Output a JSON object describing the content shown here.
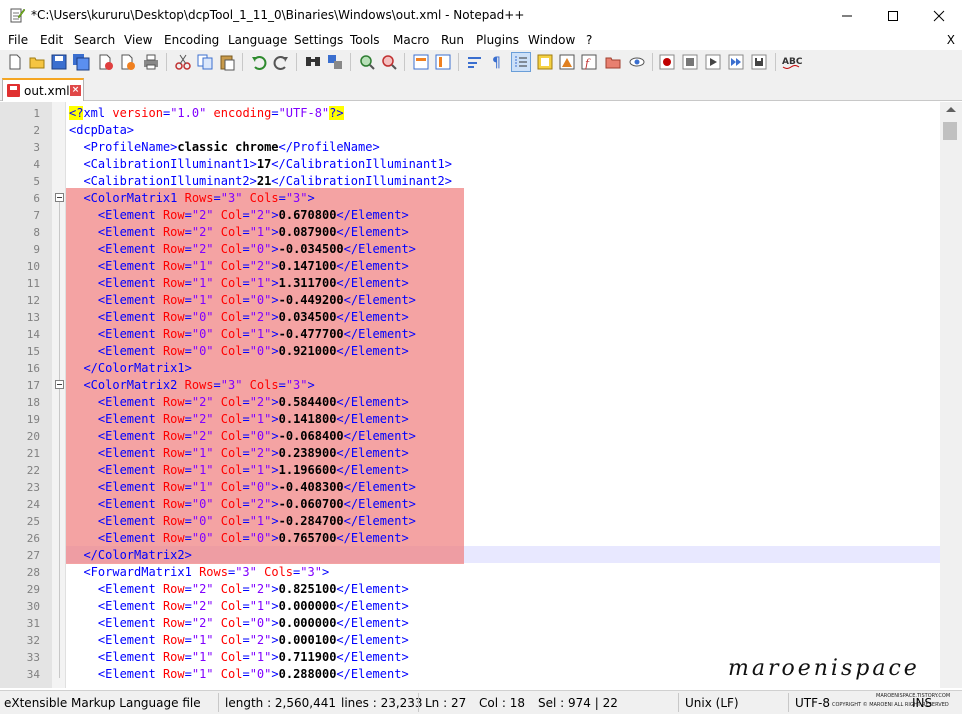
{
  "window": {
    "title": "*C:\\Users\\kururu\\Desktop\\dcpTool_1_11_0\\Binaries\\Windows\\out.xml - Notepad++"
  },
  "menu": {
    "items": [
      "File",
      "Edit",
      "Search",
      "View",
      "Encoding",
      "Language",
      "Settings",
      "Tools",
      "Macro",
      "Run",
      "Plugins",
      "Window",
      "?"
    ],
    "close": "X"
  },
  "toolbar": {
    "icons": [
      "new-file-icon",
      "open-file-icon",
      "save-icon",
      "save-all-icon",
      "close-icon",
      "close-all-icon",
      "print-icon",
      "cut-icon",
      "copy-icon",
      "paste-icon",
      "undo-icon",
      "redo-icon",
      "find-icon",
      "replace-icon",
      "zoom-in-icon",
      "zoom-out-icon",
      "sync-v-icon",
      "sync-h-icon",
      "wrap-icon",
      "all-chars-icon",
      "indent-guide-icon",
      "udl-icon",
      "doc-map-icon",
      "function-list-icon",
      "folder-workspace-icon",
      "monitor-icon",
      "record-macro-icon",
      "stop-record-icon",
      "play-macro-icon",
      "play-multiple-icon",
      "save-macro-icon",
      "spellcheck-icon"
    ]
  },
  "tab": {
    "label": "out.xml",
    "close": "×"
  },
  "editor": {
    "lines": [
      {
        "n": "1",
        "html": "<span class='pi'>&lt;?</span><span class='tagc'>xml</span> <span class='attr'>version</span><span class='tagc'>=</span><span class='val'>\"1.0\"</span> <span class='attr'>encoding</span><span class='tagc'>=</span><span class='val'>\"UTF-8\"</span><span class='pi'>?&gt;</span>"
      },
      {
        "n": "2",
        "html": "<span class='tagc'>&lt;dcpData&gt;</span>"
      },
      {
        "n": "3",
        "html": "  <span class='tagc'>&lt;ProfileName&gt;</span><span class='txt'>classic chrome</span><span class='tagc'>&lt;/ProfileName&gt;</span>"
      },
      {
        "n": "4",
        "html": "  <span class='tagc'>&lt;CalibrationIlluminant1&gt;</span><span class='txt'>17</span><span class='tagc'>&lt;/CalibrationIlluminant1&gt;</span>"
      },
      {
        "n": "5",
        "html": "  <span class='tagc'>&lt;CalibrationIlluminant2&gt;</span><span class='txt'>21</span><span class='tagc'>&lt;/CalibrationIlluminant2&gt;</span>"
      },
      {
        "n": "6",
        "html": "  <span class='tagc'>&lt;ColorMatrix1</span> <span class='attr'>Rows</span><span class='tagc'>=</span><span class='val'>\"3\"</span> <span class='attr'>Cols</span><span class='tagc'>=</span><span class='val'>\"3\"</span><span class='tagc'>&gt;</span>"
      },
      {
        "n": "7",
        "html": "    <span class='tagc'>&lt;Element</span> <span class='attr'>Row</span><span class='tagc'>=</span><span class='val'>\"2\"</span> <span class='attr'>Col</span><span class='tagc'>=</span><span class='val'>\"2\"</span><span class='tagc'>&gt;</span><span class='txt'>0.670800</span><span class='tagc'>&lt;/Element&gt;</span>"
      },
      {
        "n": "8",
        "html": "    <span class='tagc'>&lt;Element</span> <span class='attr'>Row</span><span class='tagc'>=</span><span class='val'>\"2\"</span> <span class='attr'>Col</span><span class='tagc'>=</span><span class='val'>\"1\"</span><span class='tagc'>&gt;</span><span class='txt'>0.087900</span><span class='tagc'>&lt;/Element&gt;</span>"
      },
      {
        "n": "9",
        "html": "    <span class='tagc'>&lt;Element</span> <span class='attr'>Row</span><span class='tagc'>=</span><span class='val'>\"2\"</span> <span class='attr'>Col</span><span class='tagc'>=</span><span class='val'>\"0\"</span><span class='tagc'>&gt;</span><span class='txt'>-0.034500</span><span class='tagc'>&lt;/Element&gt;</span>"
      },
      {
        "n": "10",
        "html": "    <span class='tagc'>&lt;Element</span> <span class='attr'>Row</span><span class='tagc'>=</span><span class='val'>\"1\"</span> <span class='attr'>Col</span><span class='tagc'>=</span><span class='val'>\"2\"</span><span class='tagc'>&gt;</span><span class='txt'>0.147100</span><span class='tagc'>&lt;/Element&gt;</span>"
      },
      {
        "n": "11",
        "html": "    <span class='tagc'>&lt;Element</span> <span class='attr'>Row</span><span class='tagc'>=</span><span class='val'>\"1\"</span> <span class='attr'>Col</span><span class='tagc'>=</span><span class='val'>\"1\"</span><span class='tagc'>&gt;</span><span class='txt'>1.311700</span><span class='tagc'>&lt;/Element&gt;</span>"
      },
      {
        "n": "12",
        "html": "    <span class='tagc'>&lt;Element</span> <span class='attr'>Row</span><span class='tagc'>=</span><span class='val'>\"1\"</span> <span class='attr'>Col</span><span class='tagc'>=</span><span class='val'>\"0\"</span><span class='tagc'>&gt;</span><span class='txt'>-0.449200</span><span class='tagc'>&lt;/Element&gt;</span>"
      },
      {
        "n": "13",
        "html": "    <span class='tagc'>&lt;Element</span> <span class='attr'>Row</span><span class='tagc'>=</span><span class='val'>\"0\"</span> <span class='attr'>Col</span><span class='tagc'>=</span><span class='val'>\"2\"</span><span class='tagc'>&gt;</span><span class='txt'>0.034500</span><span class='tagc'>&lt;/Element&gt;</span>"
      },
      {
        "n": "14",
        "html": "    <span class='tagc'>&lt;Element</span> <span class='attr'>Row</span><span class='tagc'>=</span><span class='val'>\"0\"</span> <span class='attr'>Col</span><span class='tagc'>=</span><span class='val'>\"1\"</span><span class='tagc'>&gt;</span><span class='txt'>-0.477700</span><span class='tagc'>&lt;/Element&gt;</span>"
      },
      {
        "n": "15",
        "html": "    <span class='tagc'>&lt;Element</span> <span class='attr'>Row</span><span class='tagc'>=</span><span class='val'>\"0\"</span> <span class='attr'>Col</span><span class='tagc'>=</span><span class='val'>\"0\"</span><span class='tagc'>&gt;</span><span class='txt'>0.921000</span><span class='tagc'>&lt;/Element&gt;</span>"
      },
      {
        "n": "16",
        "html": "  <span class='tagc'>&lt;/ColorMatrix1&gt;</span>"
      },
      {
        "n": "17",
        "html": "  <span class='tagc'>&lt;ColorMatrix2</span> <span class='attr'>Rows</span><span class='tagc'>=</span><span class='val'>\"3\"</span> <span class='attr'>Cols</span><span class='tagc'>=</span><span class='val'>\"3\"</span><span class='tagc'>&gt;</span>"
      },
      {
        "n": "18",
        "html": "    <span class='tagc'>&lt;Element</span> <span class='attr'>Row</span><span class='tagc'>=</span><span class='val'>\"2\"</span> <span class='attr'>Col</span><span class='tagc'>=</span><span class='val'>\"2\"</span><span class='tagc'>&gt;</span><span class='txt'>0.584400</span><span class='tagc'>&lt;/Element&gt;</span>"
      },
      {
        "n": "19",
        "html": "    <span class='tagc'>&lt;Element</span> <span class='attr'>Row</span><span class='tagc'>=</span><span class='val'>\"2\"</span> <span class='attr'>Col</span><span class='tagc'>=</span><span class='val'>\"1\"</span><span class='tagc'>&gt;</span><span class='txt'>0.141800</span><span class='tagc'>&lt;/Element&gt;</span>"
      },
      {
        "n": "20",
        "html": "    <span class='tagc'>&lt;Element</span> <span class='attr'>Row</span><span class='tagc'>=</span><span class='val'>\"2\"</span> <span class='attr'>Col</span><span class='tagc'>=</span><span class='val'>\"0\"</span><span class='tagc'>&gt;</span><span class='txt'>-0.068400</span><span class='tagc'>&lt;/Element&gt;</span>"
      },
      {
        "n": "21",
        "html": "    <span class='tagc'>&lt;Element</span> <span class='attr'>Row</span><span class='tagc'>=</span><span class='val'>\"1\"</span> <span class='attr'>Col</span><span class='tagc'>=</span><span class='val'>\"2\"</span><span class='tagc'>&gt;</span><span class='txt'>0.238900</span><span class='tagc'>&lt;/Element&gt;</span>"
      },
      {
        "n": "22",
        "html": "    <span class='tagc'>&lt;Element</span> <span class='attr'>Row</span><span class='tagc'>=</span><span class='val'>\"1\"</span> <span class='attr'>Col</span><span class='tagc'>=</span><span class='val'>\"1\"</span><span class='tagc'>&gt;</span><span class='txt'>1.196600</span><span class='tagc'>&lt;/Element&gt;</span>"
      },
      {
        "n": "23",
        "html": "    <span class='tagc'>&lt;Element</span> <span class='attr'>Row</span><span class='tagc'>=</span><span class='val'>\"1\"</span> <span class='attr'>Col</span><span class='tagc'>=</span><span class='val'>\"0\"</span><span class='tagc'>&gt;</span><span class='txt'>-0.408300</span><span class='tagc'>&lt;/Element&gt;</span>"
      },
      {
        "n": "24",
        "html": "    <span class='tagc'>&lt;Element</span> <span class='attr'>Row</span><span class='tagc'>=</span><span class='val'>\"0\"</span> <span class='attr'>Col</span><span class='tagc'>=</span><span class='val'>\"2\"</span><span class='tagc'>&gt;</span><span class='txt'>-0.060700</span><span class='tagc'>&lt;/Element&gt;</span>"
      },
      {
        "n": "25",
        "html": "    <span class='tagc'>&lt;Element</span> <span class='attr'>Row</span><span class='tagc'>=</span><span class='val'>\"0\"</span> <span class='attr'>Col</span><span class='tagc'>=</span><span class='val'>\"1\"</span><span class='tagc'>&gt;</span><span class='txt'>-0.284700</span><span class='tagc'>&lt;/Element&gt;</span>"
      },
      {
        "n": "26",
        "html": "    <span class='tagc'>&lt;Element</span> <span class='attr'>Row</span><span class='tagc'>=</span><span class='val'>\"0\"</span> <span class='attr'>Col</span><span class='tagc'>=</span><span class='val'>\"0\"</span><span class='tagc'>&gt;</span><span class='txt'>0.765700</span><span class='tagc'>&lt;/Element&gt;</span>"
      },
      {
        "n": "27",
        "html": "  <span class='tagc'>&lt;/ColorMatrix2&gt;</span>"
      },
      {
        "n": "28",
        "html": "  <span class='tagc'>&lt;ForwardMatrix1</span> <span class='attr'>Rows</span><span class='tagc'>=</span><span class='val'>\"3\"</span> <span class='attr'>Cols</span><span class='tagc'>=</span><span class='val'>\"3\"</span><span class='tagc'>&gt;</span>"
      },
      {
        "n": "29",
        "html": "    <span class='tagc'>&lt;Element</span> <span class='attr'>Row</span><span class='tagc'>=</span><span class='val'>\"2\"</span> <span class='attr'>Col</span><span class='tagc'>=</span><span class='val'>\"2\"</span><span class='tagc'>&gt;</span><span class='txt'>0.825100</span><span class='tagc'>&lt;/Element&gt;</span>"
      },
      {
        "n": "30",
        "html": "    <span class='tagc'>&lt;Element</span> <span class='attr'>Row</span><span class='tagc'>=</span><span class='val'>\"2\"</span> <span class='attr'>Col</span><span class='tagc'>=</span><span class='val'>\"1\"</span><span class='tagc'>&gt;</span><span class='txt'>0.000000</span><span class='tagc'>&lt;/Element&gt;</span>"
      },
      {
        "n": "31",
        "html": "    <span class='tagc'>&lt;Element</span> <span class='attr'>Row</span><span class='tagc'>=</span><span class='val'>\"2\"</span> <span class='attr'>Col</span><span class='tagc'>=</span><span class='val'>\"0\"</span><span class='tagc'>&gt;</span><span class='txt'>0.000000</span><span class='tagc'>&lt;/Element&gt;</span>"
      },
      {
        "n": "32",
        "html": "    <span class='tagc'>&lt;Element</span> <span class='attr'>Row</span><span class='tagc'>=</span><span class='val'>\"1\"</span> <span class='attr'>Col</span><span class='tagc'>=</span><span class='val'>\"2\"</span><span class='tagc'>&gt;</span><span class='txt'>0.000100</span><span class='tagc'>&lt;/Element&gt;</span>"
      },
      {
        "n": "33",
        "html": "    <span class='tagc'>&lt;Element</span> <span class='attr'>Row</span><span class='tagc'>=</span><span class='val'>\"1\"</span> <span class='attr'>Col</span><span class='tagc'>=</span><span class='val'>\"1\"</span><span class='tagc'>&gt;</span><span class='txt'>0.711900</span><span class='tagc'>&lt;/Element&gt;</span>"
      },
      {
        "n": "34",
        "html": "    <span class='tagc'>&lt;Element</span> <span class='attr'>Row</span><span class='tagc'>=</span><span class='val'>\"1\"</span> <span class='attr'>Col</span><span class='tagc'>=</span><span class='val'>\"0\"</span><span class='tagc'>&gt;</span><span class='txt'>0.288000</span><span class='tagc'>&lt;/Element&gt;</span>"
      }
    ]
  },
  "status": {
    "filetype": "eXtensible Markup Language file",
    "length": "length : 2,560,441",
    "lines": "lines : 23,233",
    "ln": "Ln : 27",
    "col": "Col : 18",
    "sel": "Sel : 974 | 22",
    "eol": "Unix (LF)",
    "encoding": "UTF-8",
    "ins": "INS"
  },
  "watermark": {
    "script": "maroenispace",
    "url": "MAROENISPACE.TISTORY.COM",
    "copyright": "COPYRIGHT © MAROENI ALL RIGHT RESERVED"
  }
}
